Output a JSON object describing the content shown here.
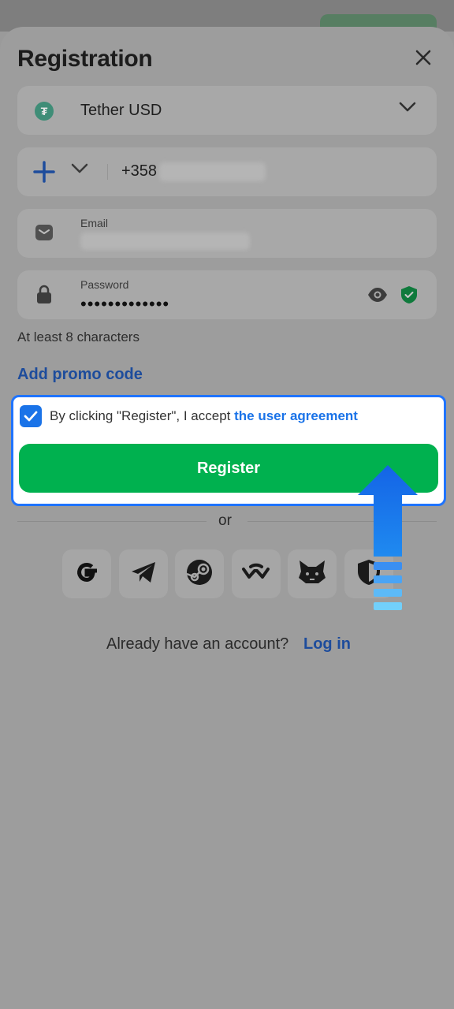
{
  "header": {
    "title": "Registration"
  },
  "currency": {
    "label": "Tether USD",
    "icon": "tether-icon"
  },
  "phone": {
    "code": "+358"
  },
  "email": {
    "label": "Email"
  },
  "password": {
    "label": "Password",
    "masked_value": "•••••••••••••",
    "hint": "At least 8 characters"
  },
  "promo": {
    "label": "Add promo code"
  },
  "agreement": {
    "checked": true,
    "text": "By clicking \"Register\", I accept ",
    "link": "the user agreement"
  },
  "register": {
    "label": "Register"
  },
  "divider": {
    "label": "or"
  },
  "social": [
    "google-icon",
    "telegram-icon",
    "steam-icon",
    "walletconnect-icon",
    "metamask-icon",
    "shield-wallet-icon"
  ],
  "footer": {
    "prompt": "Already have an account?",
    "login_label": "Log in"
  },
  "colors": {
    "accent_green": "#00b14f",
    "accent_blue": "#1a73e8",
    "highlight_border": "#1f74ff"
  }
}
